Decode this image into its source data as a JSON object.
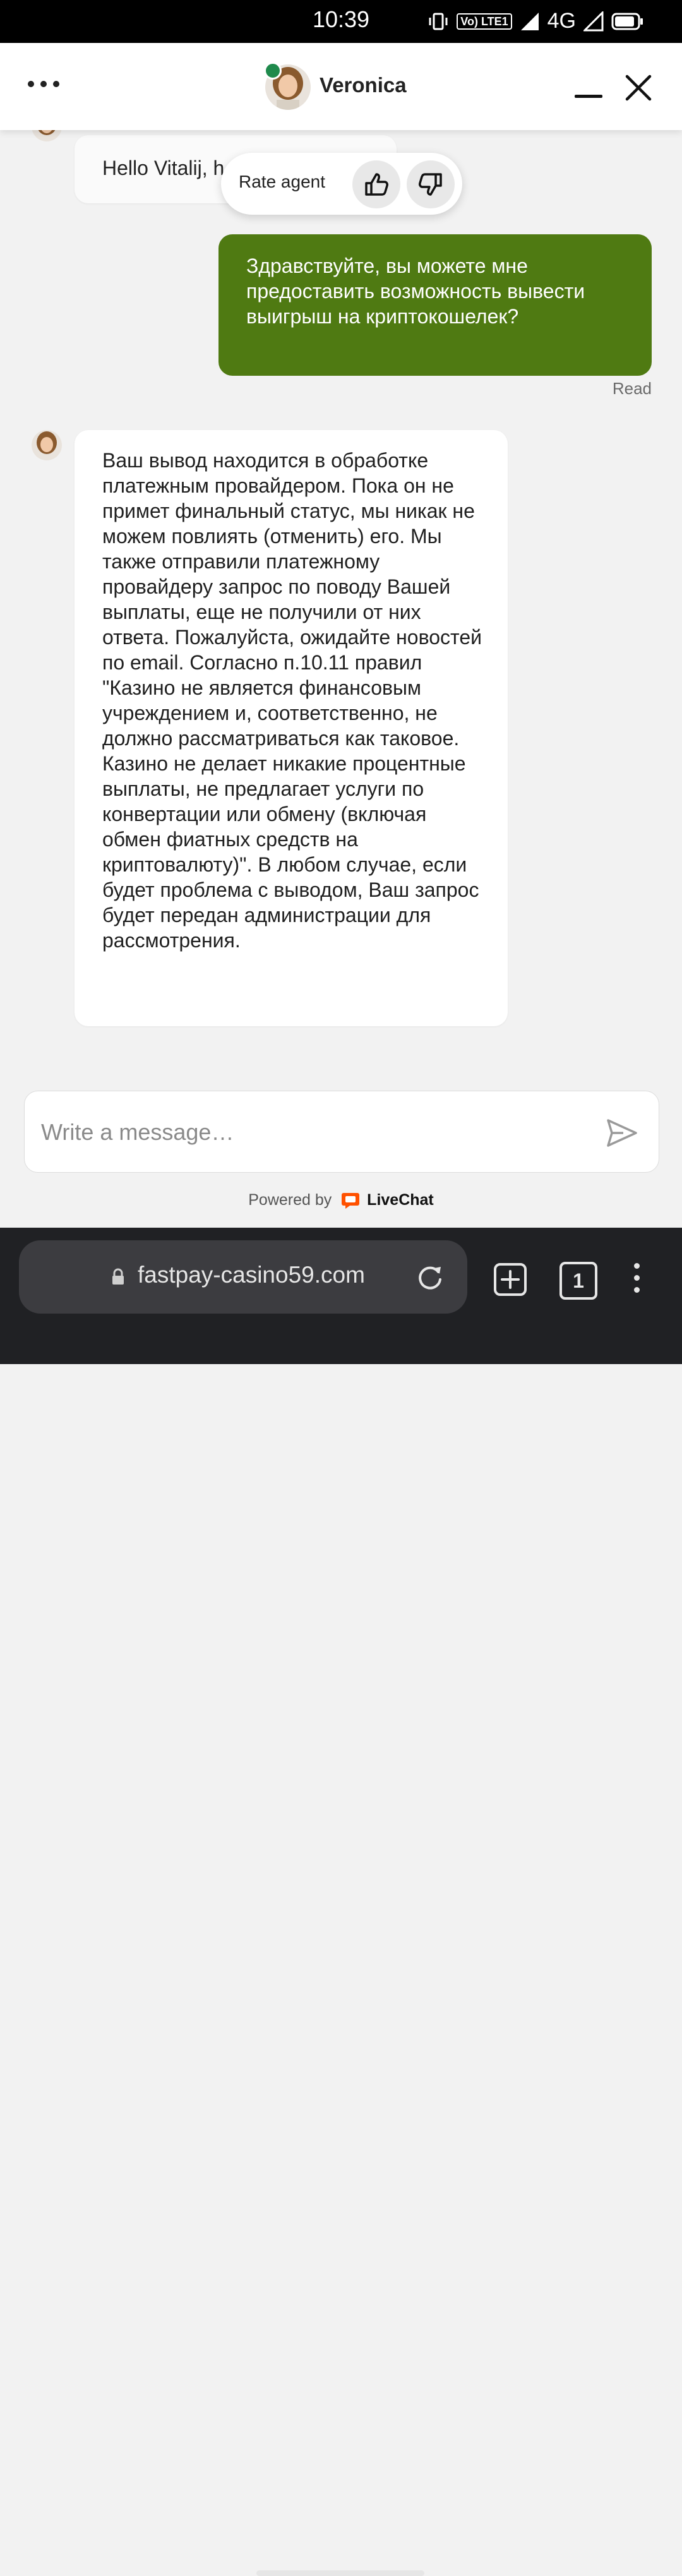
{
  "status_bar": {
    "time": "10:39",
    "network": "4G",
    "lte_badge": "Vo) LTE1"
  },
  "header": {
    "agent_name": "Veronica"
  },
  "messages": {
    "incoming_partial": "Hello Vitalij, h",
    "outgoing": "Здравствуйте, вы можете мне предоставить возможность вывести выигрыш на криптокошелек?",
    "read_status": "Read",
    "incoming_long": "Ваш вывод находится в обработке платежным провайдером. Пока он не примет финальный статус, мы никак не можем повлиять (отменить) его. Мы также отправили платежному провайдеру запрос по поводу Вашей выплаты, еще не получили от них ответа. Пожалуйста, ожидайте новостей по email. Согласно п.10.11 правил \"Казино не является финансовым учреждением и, соответственно, не должно рассматриваться как таковое. Казино не делает никакие процентные выплаты, не предлагает услуги по конвертации или обмену (включая обмен фиатных средств на криптовалюту)\". В любом случае, если будет проблема с выводом, Ваш запрос будет передан администрации для рассмотрения."
  },
  "rating": {
    "label": "Rate agent"
  },
  "composer": {
    "placeholder": "Write a message…",
    "value": ""
  },
  "footer": {
    "powered_by": "Powered by",
    "brand": "LiveChat"
  },
  "browser": {
    "url": "fastpay-casino59.com",
    "tab_count": "1"
  },
  "colors": {
    "outgoing_bubble": "#4f7a12",
    "online": "#1f8a4c",
    "brand": "#ff5100"
  }
}
